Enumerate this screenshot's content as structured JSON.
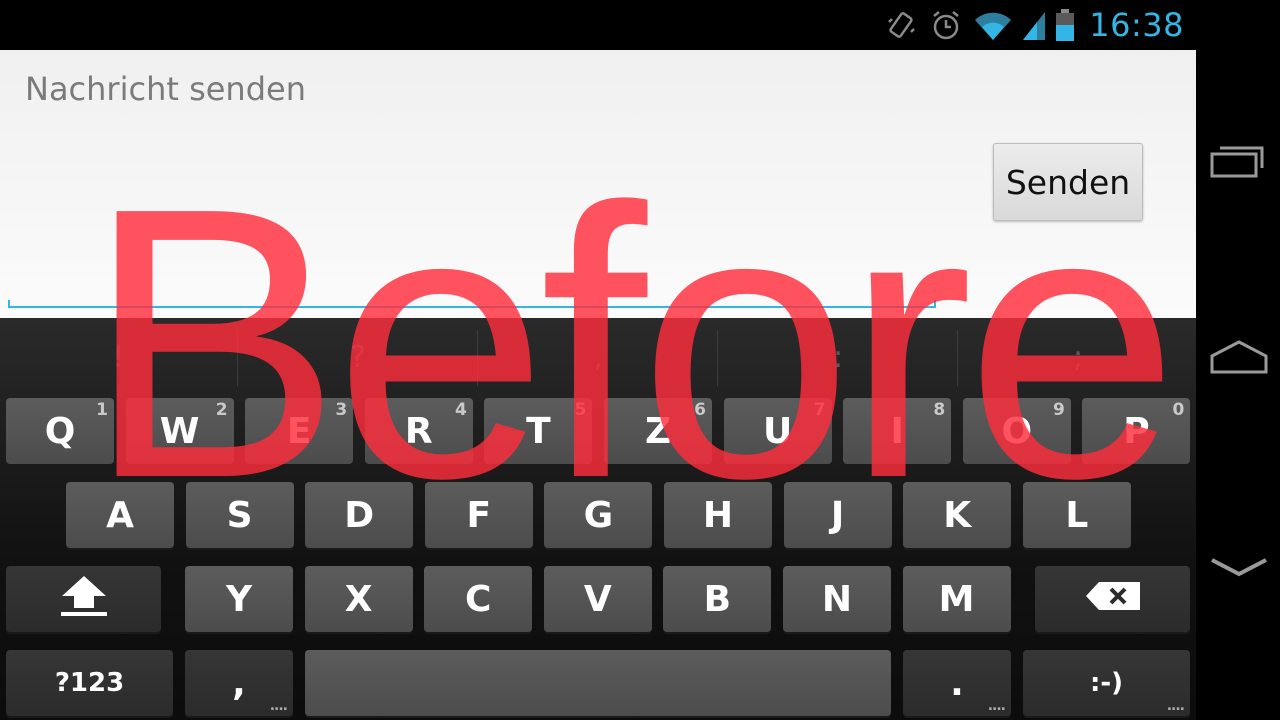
{
  "status_bar": {
    "time": "16:38",
    "icons": [
      "vibrate-icon",
      "alarm-icon",
      "wifi-icon",
      "signal-icon",
      "battery-icon"
    ],
    "accent_color": "#33b5e5"
  },
  "compose": {
    "hint": "Nachricht senden",
    "send_label": "Senden"
  },
  "suggestions": [
    "!",
    "?",
    ",",
    ":",
    ";"
  ],
  "keyboard": {
    "row1": [
      {
        "label": "Q",
        "hint": "1"
      },
      {
        "label": "W",
        "hint": "2"
      },
      {
        "label": "E",
        "hint": "3"
      },
      {
        "label": "R",
        "hint": "4"
      },
      {
        "label": "T",
        "hint": "5"
      },
      {
        "label": "Z",
        "hint": "6"
      },
      {
        "label": "U",
        "hint": "7"
      },
      {
        "label": "I",
        "hint": "8"
      },
      {
        "label": "O",
        "hint": "9"
      },
      {
        "label": "P",
        "hint": "0"
      }
    ],
    "row2": [
      "A",
      "S",
      "D",
      "F",
      "G",
      "H",
      "J",
      "K",
      "L"
    ],
    "row3": [
      "Y",
      "X",
      "C",
      "V",
      "B",
      "N",
      "M"
    ],
    "symbols_label": "?123",
    "comma_label": ",",
    "period_label": ".",
    "smiley_label": ":-)",
    "more_indicator": "...."
  },
  "overlay_text": "Before",
  "overlay_color": "#ff2d3c"
}
